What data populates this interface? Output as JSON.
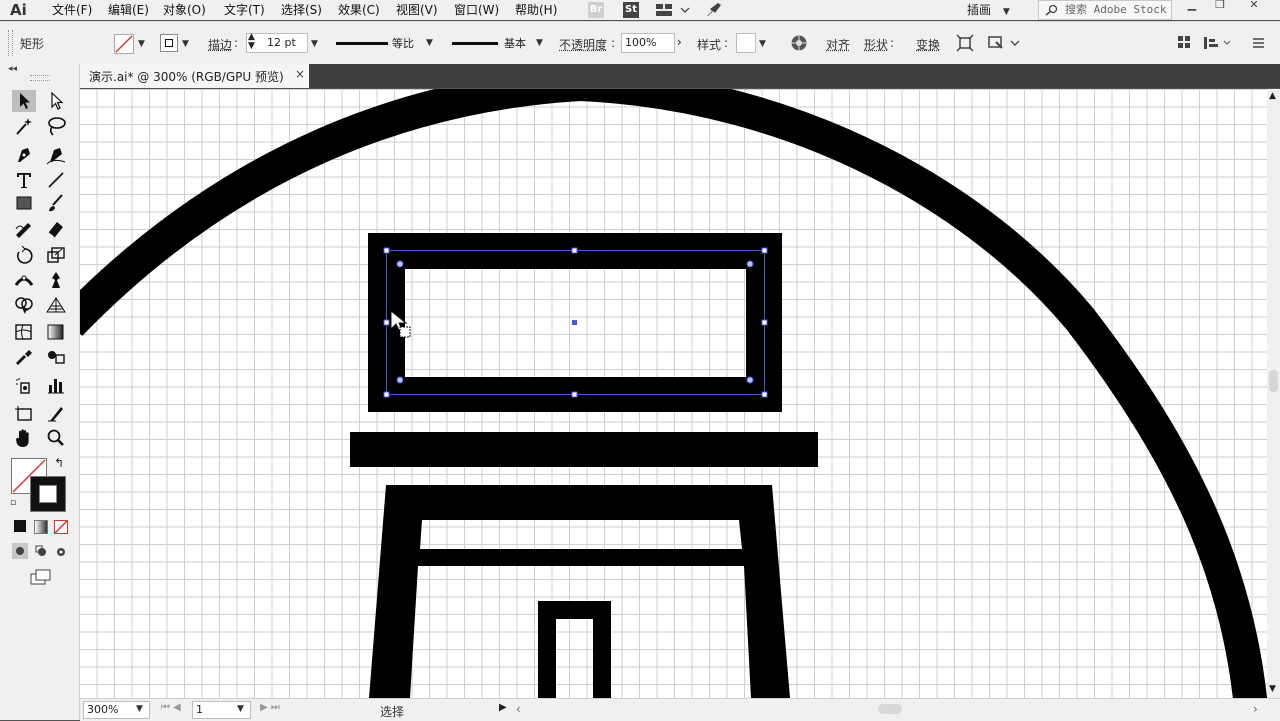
{
  "app": {
    "logo": "Ai"
  },
  "menu": [
    "文件(F)",
    "编辑(E)",
    "对象(O)",
    "文字(T)",
    "选择(S)",
    "效果(C)",
    "视图(V)",
    "窗口(W)",
    "帮助(H)"
  ],
  "menubar_icons": {
    "bridge": "Br",
    "stock": "St"
  },
  "workspace": "插画",
  "search": {
    "placeholder": "搜索 Adobe Stock"
  },
  "control_bar": {
    "selection_type": "矩形",
    "stroke_label": "描边",
    "stroke_weight": "12 pt",
    "profile_label": "等比",
    "brush_label": "基本",
    "opacity_label": "不透明度",
    "opacity_value": "100%",
    "style_label": "样式",
    "align_label": "对齐",
    "shape_label": "形状",
    "transform_label": "变换",
    "colors": {
      "fill": "#000000",
      "stroke_none": "#d33"
    }
  },
  "document_tab": {
    "title": "演示.ai* @ 300% (RGB/GPU 预览)",
    "close": "×"
  },
  "status_bar": {
    "zoom": "300%",
    "page": "1",
    "status": "选择"
  },
  "canvas": {
    "zoom_percent": 300,
    "grid": true
  },
  "colors": {
    "chrome": "#f0f0f0",
    "dark_bg": "#535353",
    "accent_selection": "#4a5ad6",
    "artwork": "#000000"
  }
}
